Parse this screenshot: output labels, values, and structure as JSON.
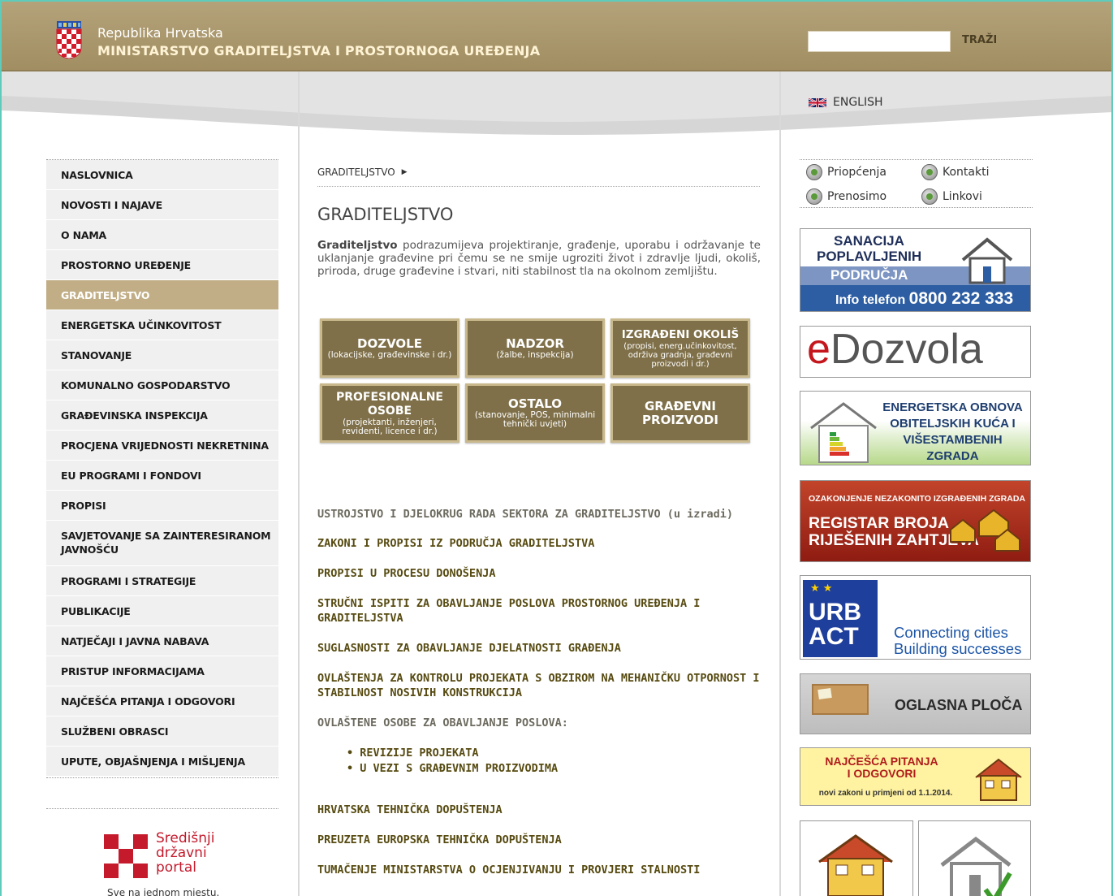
{
  "header": {
    "country": "Republika Hrvatska",
    "ministry": "MINISTARSTVO GRADITELJSTVA I PROSTORNOGA UREĐENJA",
    "search_value": "",
    "search_button": "TRAŽI"
  },
  "language": {
    "label": "ENGLISH"
  },
  "nav": [
    {
      "label": "NASLOVNICA"
    },
    {
      "label": "NOVOSTI I NAJAVE"
    },
    {
      "label": "O NAMA"
    },
    {
      "label": "PROSTORNO UREĐENJE"
    },
    {
      "label": "GRADITELJSTVO",
      "active": true
    },
    {
      "label": "ENERGETSKA UČINKOVITOST"
    },
    {
      "label": "STANOVANJE"
    },
    {
      "label": "KOMUNALNO GOSPODARSTVO"
    },
    {
      "label": "GRAĐEVINSKA INSPEKCIJA"
    },
    {
      "label": "PROCJENA VRIJEDNOSTI NEKRETNINA"
    },
    {
      "label": "EU PROGRAMI I FONDOVI"
    },
    {
      "label": "PROPISI"
    },
    {
      "label": "SAVJETOVANJE SA ZAINTERESIRANOM JAVNOŠĆU"
    },
    {
      "label": "PROGRAMI I STRATEGIJE"
    },
    {
      "label": "PUBLIKACIJE"
    },
    {
      "label": "NATJEČAJI I JAVNA NABAVA"
    },
    {
      "label": "PRISTUP INFORMACIJAMA"
    },
    {
      "label": "NAJČEŠĆA PITANJA I ODGOVORI"
    },
    {
      "label": "SLUŽBENI OBRASCI"
    },
    {
      "label": "UPUTE, OBJAŠNJENJA I MIŠLJENJA"
    }
  ],
  "portal": {
    "line1": "Središnji",
    "line2": "državni",
    "line3": "portal",
    "tagline": "Sve na jednom mjestu."
  },
  "content": {
    "breadcrumb": "GRADITELJSTVO",
    "title": "GRADITELJSTVO",
    "intro_bold": "Graditeljstvo",
    "intro_rest": " podrazumijeva projektiranje, građenje, uporabu i održavanje te uklanjanje građevine pri čemu se ne smije ugroziti život i zdravlje ljudi, okoliš, priroda, druge građevine i stvari, niti stabilnost tla na okolnom zemljištu.",
    "tiles": [
      {
        "title": "DOZVOLE",
        "sub": "(lokacijske, građevinske i dr.)"
      },
      {
        "title": "NADZOR",
        "sub": "(žalbe, inspekcija)"
      },
      {
        "title": "IZGRAĐENI OKOLIŠ",
        "sub": "(propisi, energ.učinkovitost, održiva gradnja, građevni proizvodi i dr.)"
      },
      {
        "title": "PROFESIONALNE OSOBE",
        "sub": "(projektanti, inženjeri, revidenti, licence i dr.)"
      },
      {
        "title": "OSTALO",
        "sub": "(stanovanje, POS, minimalni tehnički uvjeti)"
      },
      {
        "title": "GRAĐEVNI PROIZVODI",
        "sub": ""
      }
    ],
    "links": [
      {
        "label": "USTROJSTVO I DJELOKRUG RADA SEKTORA ZA GRADITELJSTVO (u izradi)",
        "grey": true
      },
      {
        "label": "ZAKONI I PROPISI IZ PODRUČJA GRADITELJSTVA"
      },
      {
        "label": "PROPISI U PROCESU DONOŠENJA"
      },
      {
        "label": "STRUČNI ISPITI ZA OBAVLJANJE POSLOVA PROSTORNOG UREĐENJA I GRADITELJSTVA"
      },
      {
        "label": "SUGLASNOSTI ZA OBAVLJANJE DJELATNOSTI GRAĐENJA"
      },
      {
        "label": "OVLAŠTENJA ZA KONTROLU PROJEKATA S OBZIROM NA MEHANIČKU OTPORNOST I STABILNOST NOSIVIH KONSTRUKCIJA"
      },
      {
        "label": "OVLAŠTENE OSOBE ZA OBAVLJANJE POSLOVA:",
        "grey": true
      }
    ],
    "sublinks": [
      "REVIZIJE PROJEKATA",
      "U VEZI S GRAĐEVNIM PROIZVODIMA"
    ],
    "links2": [
      {
        "label": "HRVATSKA TEHNIČKA DOPUŠTENJA"
      },
      {
        "label": "PREUZETA EUROPSKA TEHNIČKA DOPUŠTENJA"
      },
      {
        "label": "TUMAČENJE MINISTARSTVA O OCJENJIVANJU I PROVJERI STALNOSTI"
      }
    ]
  },
  "quicklinks": {
    "priopcenja": "Priopćenja",
    "kontakti": "Kontakti",
    "prenosimo": "Prenosimo",
    "linkovi": "Linkovi"
  },
  "banners": {
    "sanacija_l1": "SANACIJA",
    "sanacija_l2": "POPLAVLJENIH",
    "sanacija_l3": "PODRUČJA",
    "sanacija_info": "Info telefon",
    "sanacija_phone": "0800 232 333",
    "edozvola_e": "e",
    "edozvola_rest": "Dozvola",
    "energ_l1": "ENERGETSKA OBNOVA",
    "energ_l2": "OBITELJSKIH KUĆA I",
    "energ_l3": "VIŠESTAMBENIH ZGRADA",
    "registar_l1": "OZAKONJENJE NEZAKONITO IZGRAĐENIH ZGRADA",
    "registar_l2": "REGISTAR BROJA",
    "registar_l3": "RIJEŠENIH ZAHTJEVA",
    "urbact_l1": "URB",
    "urbact_l2": "ACT",
    "urbact_c1": "Connecting cities",
    "urbact_c2": "Building successes",
    "oglasna": "OGLASNA PLOČA",
    "najcesca_l1": "NAJČEŠĆA PITANJA",
    "najcesca_l2": "I ODGOVORI",
    "najcesca_sub": "novi zakoni u primjeni od 1.1.2014."
  },
  "colors": {
    "header": "#a8956a",
    "nav_active": "#c1ae86",
    "tile": "#7f7049",
    "link": "#574b12"
  }
}
